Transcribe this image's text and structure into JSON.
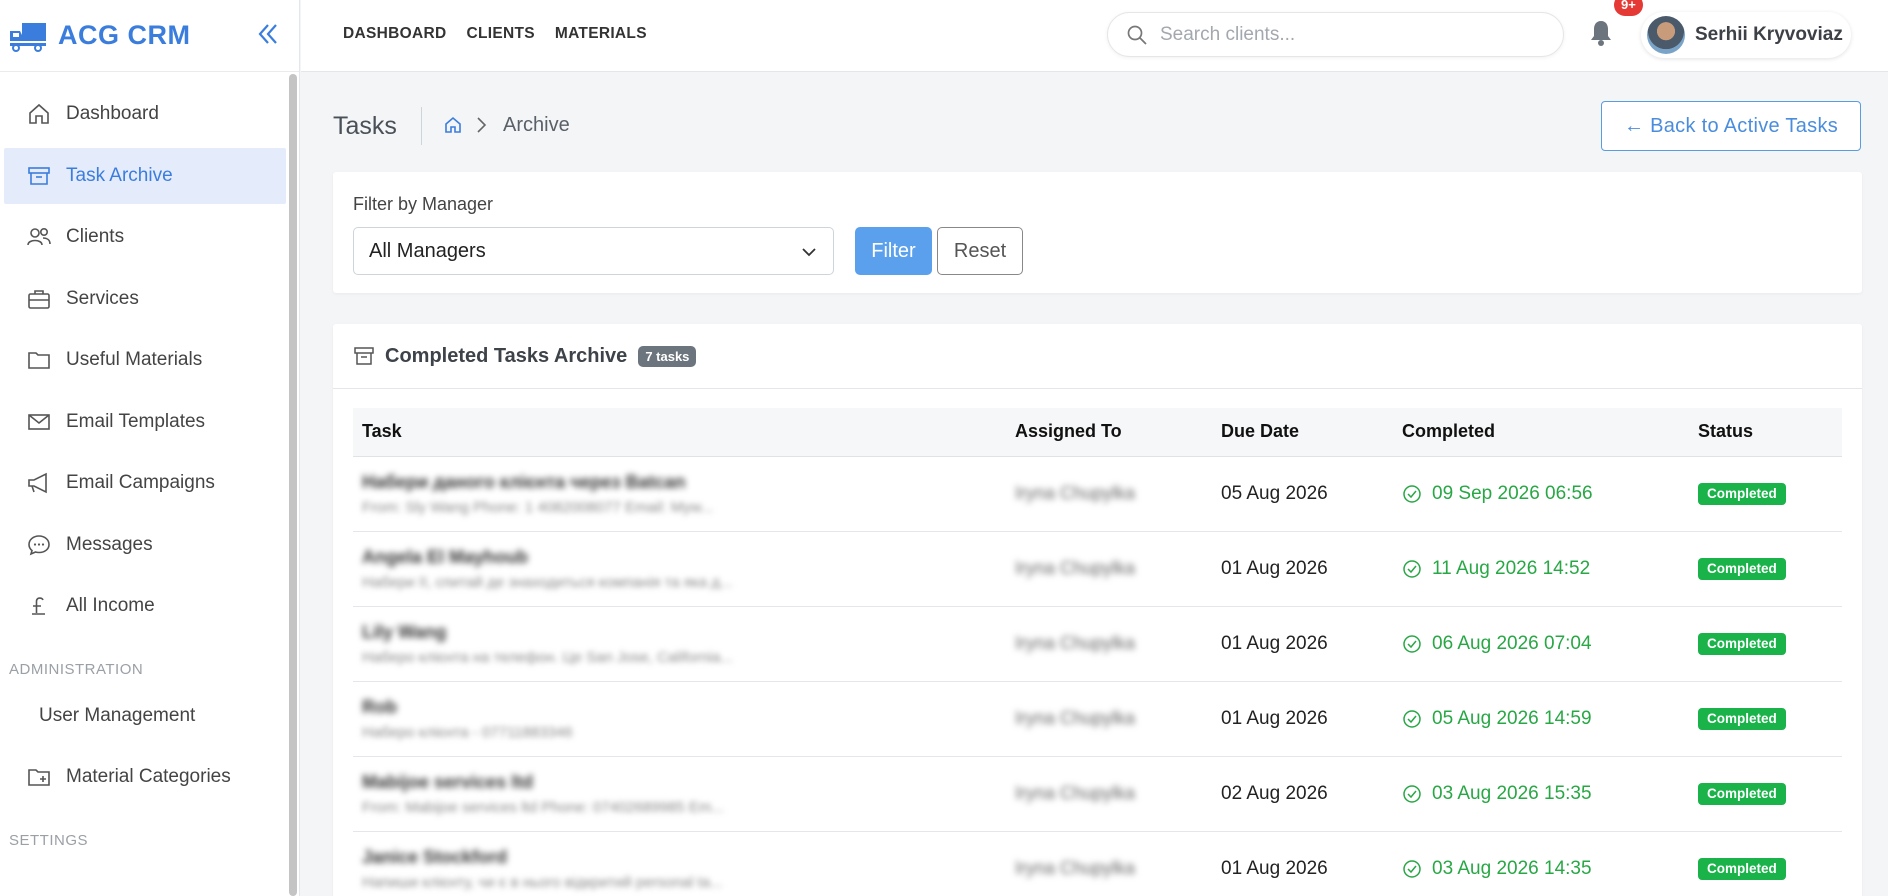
{
  "app": {
    "name": "ACG CRM"
  },
  "topnav": [
    {
      "label": "DASHBOARD"
    },
    {
      "label": "CLIENTS"
    },
    {
      "label": "MATERIALS"
    }
  ],
  "search": {
    "placeholder": "Search clients..."
  },
  "notifications": {
    "badge": "9+"
  },
  "user": {
    "name": "Serhii Kryvoviaz"
  },
  "sidebar": {
    "items": [
      {
        "label": "Dashboard",
        "icon": "home-icon"
      },
      {
        "label": "Task Archive",
        "icon": "archive-icon",
        "active": true
      },
      {
        "label": "Clients",
        "icon": "users-icon"
      },
      {
        "label": "Services",
        "icon": "briefcase-icon"
      },
      {
        "label": "Useful Materials",
        "icon": "folder-icon"
      },
      {
        "label": "Email Templates",
        "icon": "envelope-icon"
      },
      {
        "label": "Email Campaigns",
        "icon": "megaphone-icon"
      },
      {
        "label": "Messages",
        "icon": "chat-icon"
      },
      {
        "label": "All Income",
        "icon": "pound-icon"
      }
    ],
    "admin_section": "ADMINISTRATION",
    "admin_items": [
      {
        "label": "User Management"
      },
      {
        "label": "Material Categories",
        "icon": "folder-plus-icon"
      }
    ],
    "settings_section": "SETTINGS"
  },
  "page": {
    "title": "Tasks",
    "breadcrumb_current": "Archive",
    "back_button": "← Back to Active Tasks"
  },
  "filter": {
    "label": "Filter by Manager",
    "selected": "All Managers",
    "filter_button": "Filter",
    "reset_button": "Reset"
  },
  "archive": {
    "title": "Completed Tasks Archive",
    "count_badge": "7 tasks",
    "columns": [
      "Task",
      "Assigned To",
      "Due Date",
      "Completed",
      "Status"
    ],
    "rows": [
      {
        "task": "Набери даного клієнта через Batcan",
        "subtitle": "From: Sly Wang Phone: 1 4082008077 Email: Myw...",
        "assigned": "Iryna Chupylka",
        "due": "05 Aug 2026",
        "completed": "09 Sep 2026 06:56",
        "status": "Completed"
      },
      {
        "task": "Angela El Mayhoub",
        "subtitle": "Набери її, спитай де знаходиться компанія та яка д...",
        "assigned": "Iryna Chupylka",
        "due": "01 Aug 2026",
        "completed": "11 Aug 2026 14:52",
        "status": "Completed"
      },
      {
        "task": "Lily Wang",
        "subtitle": "Наберо клієнта на телефон. Цe San Jose, California...",
        "assigned": "Iryna Chupylka",
        "due": "01 Aug 2026",
        "completed": "06 Aug 2026 07:04",
        "status": "Completed"
      },
      {
        "task": "Rob",
        "subtitle": "Наберо клієнта - 07711883346",
        "assigned": "Iryna Chupylka",
        "due": "01 Aug 2026",
        "completed": "05 Aug 2026 14:59",
        "status": "Completed"
      },
      {
        "task": "Mabijoe services ltd",
        "subtitle": "From: Mabijoe services ltd Phone: 07402689985 Em...",
        "assigned": "Iryna Chupylka",
        "due": "02 Aug 2026",
        "completed": "03 Aug 2026 15:35",
        "status": "Completed"
      },
      {
        "task": "Janice Stockford",
        "subtitle": "Напиши клієнту, чи є в нього відкритий personal ta...",
        "assigned": "Iryna Chupylka",
        "due": "01 Aug 2026",
        "completed": "03 Aug 2026 14:35",
        "status": "Completed"
      }
    ]
  },
  "colors": {
    "accent": "#3b7ddd",
    "success": "#28a745",
    "badge": "#19b34a",
    "notification": "#e53935"
  }
}
